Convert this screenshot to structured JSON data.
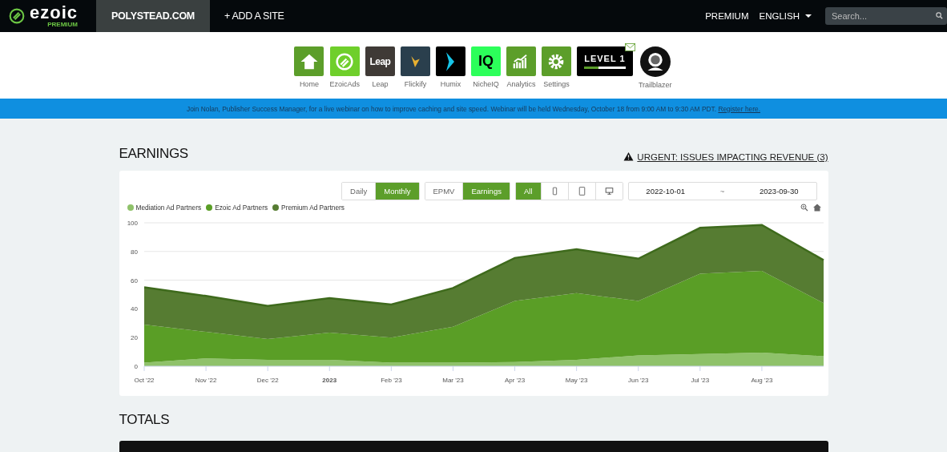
{
  "topbar": {
    "logo": {
      "name": "ezoic",
      "tier": "PREMIUM"
    },
    "sites": [
      {
        "label": "POLYSTEAD.COM",
        "selected": true
      },
      {
        "label": "+ ADD A SITE",
        "selected": false
      }
    ],
    "links": [
      {
        "label": "PREMIUM",
        "kind": "link"
      },
      {
        "label": "ENGLISH",
        "kind": "dropdown"
      }
    ],
    "search": {
      "placeholder": "Search..."
    }
  },
  "apps": [
    {
      "label": "Home",
      "kind": "home"
    },
    {
      "label": "EzoicAds",
      "kind": "ezoicads"
    },
    {
      "label": "Leap",
      "kind": "leap",
      "mark": "Leap"
    },
    {
      "label": "Flickify",
      "kind": "flickify"
    },
    {
      "label": "Humix",
      "kind": "humix"
    },
    {
      "label": "NicheIQ",
      "kind": "nicheiq",
      "mark": "IQ"
    },
    {
      "label": "Analytics",
      "kind": "analytics"
    },
    {
      "label": "Settings",
      "kind": "settings"
    },
    {
      "kind": "level",
      "mark": "LEVEL 1",
      "level": 0.35
    },
    {
      "label": "Trailblazer",
      "kind": "avatar"
    }
  ],
  "banner": {
    "text": "Join Nolan, Publisher Success Manager, for a live webinar on how to improve caching and site speed. Webinar will be held Wednesday, October 18 from 9:00 AM to 9:30 AM PDT.",
    "link": "Register here."
  },
  "earnings": {
    "title": "EARNINGS",
    "alert": "URGENT: ISSUES IMPACTING REVENUE (3)",
    "toggles": [
      [
        {
          "kind": "text",
          "label": "Daily",
          "selected": false
        },
        {
          "kind": "text",
          "label": "Monthly",
          "selected": true
        }
      ],
      [
        {
          "kind": "text",
          "label": "EPMV",
          "selected": false
        },
        {
          "kind": "text",
          "label": "Earnings",
          "selected": true
        }
      ],
      [
        {
          "kind": "text",
          "label": "All",
          "selected": true
        },
        {
          "kind": "mobile",
          "selected": false
        },
        {
          "kind": "tablet",
          "selected": false
        },
        {
          "kind": "desktop",
          "selected": false
        }
      ]
    ],
    "date_range": {
      "start": "2022-10-01",
      "separator": "~",
      "end": "2023-09-30"
    },
    "chart_data": {
      "type": "area",
      "stacked": true,
      "grid": true,
      "categories": [
        "Oct '22",
        "Nov '22",
        "Dec '22",
        "**2023**",
        "Feb '23",
        "Mar '23",
        "Apr '23",
        "May '23",
        "Jun '23",
        "Jul '23",
        "Aug '23",
        null
      ],
      "ylim": [
        0,
        100
      ],
      "yticks": [
        0,
        20,
        40,
        60,
        80,
        100
      ],
      "series": [
        {
          "name": "Mediation Ad Partners",
          "color": "#8fc26a",
          "values": [
            2.5,
            5.5,
            4.5,
            4.5,
            2.5,
            2.5,
            3,
            4.5,
            7.5,
            8.5,
            9.5,
            7
          ]
        },
        {
          "name": "Ezoic Ad Partners",
          "color": "#5a9e26",
          "values": [
            26.5,
            18.5,
            14.5,
            19,
            17.5,
            25,
            42.5,
            46.5,
            38,
            56,
            57,
            37
          ]
        },
        {
          "name": "Premium Ad Partners",
          "color": "#567c32",
          "values": [
            26,
            25,
            23,
            24,
            23,
            27,
            30,
            30.5,
            29.5,
            32,
            32,
            30
          ]
        }
      ]
    }
  },
  "totals": {
    "title": "TOTALS"
  }
}
